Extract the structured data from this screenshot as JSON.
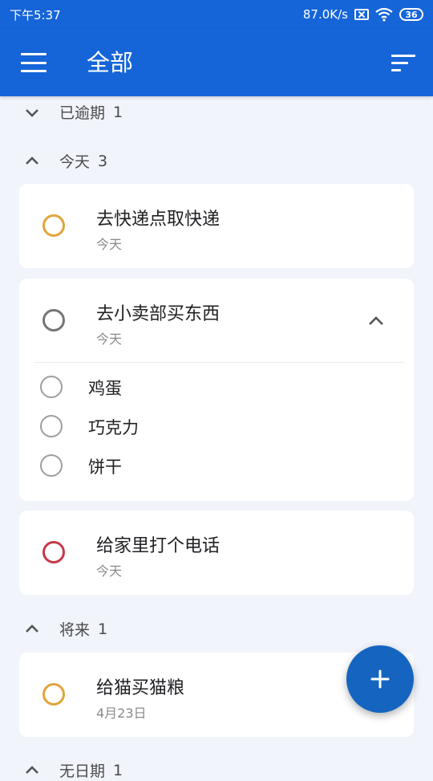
{
  "status_bar": {
    "time": "下午5:37",
    "network_speed": "87.0K/s",
    "battery": "36",
    "icons": [
      "sim-off-icon",
      "wifi-icon",
      "battery-icon"
    ]
  },
  "app_bar": {
    "title": "全部",
    "icons": [
      "menu-icon",
      "sort-icon"
    ]
  },
  "sections": {
    "overdue": {
      "label": "已逾期",
      "count": "1",
      "expanded": false
    },
    "today": {
      "label": "今天",
      "count": "3",
      "expanded": true
    },
    "future": {
      "label": "将来",
      "count": "1",
      "expanded": true
    },
    "nodate": {
      "label": "无日期",
      "count": "1",
      "expanded": true
    }
  },
  "tasks": {
    "express": {
      "title": "去快递点取快递",
      "date": "今天",
      "color": "#e0a53c"
    },
    "store": {
      "title": "去小卖部买东西",
      "date": "今天",
      "color": "#757575",
      "subtasks": [
        "鸡蛋",
        "巧克力",
        "饼干"
      ]
    },
    "call": {
      "title": "给家里打个电话",
      "date": "今天",
      "color": "#c5394a"
    },
    "catfood": {
      "title": "给猫买猫粮",
      "date": "4月23日",
      "color": "#e0a53c"
    }
  },
  "theme": {
    "primary": "#1565d8",
    "fab": "#1565c0",
    "background": "#f1f4fb"
  }
}
